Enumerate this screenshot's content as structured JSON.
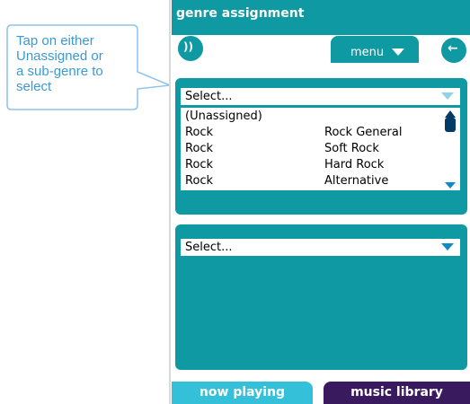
{
  "callout": {
    "lines": [
      "Tap on either",
      "Unassigned or",
      "a sub-genre to",
      "select"
    ]
  },
  "header": {
    "title": "genre assignment"
  },
  "toolbar": {
    "speaker_icon": "speaker-icon",
    "menu_label": "menu",
    "back_icon": "arrow-left-icon"
  },
  "genre_select": {
    "value": "Select...",
    "options": [
      {
        "genre": "(Unassigned)",
        "subgenre": ""
      },
      {
        "genre": "Rock",
        "subgenre": "Rock General"
      },
      {
        "genre": "Rock",
        "subgenre": "Soft Rock"
      },
      {
        "genre": "Rock",
        "subgenre": "Hard Rock"
      },
      {
        "genre": "Rock",
        "subgenre": "Alternative"
      }
    ]
  },
  "second_select": {
    "value": "Select..."
  },
  "tabs": {
    "now_playing": "now playing",
    "music_library": "music library"
  },
  "colors": {
    "teal": "#0e99a3",
    "light_blue": "#35c0d9",
    "purple": "#3a1a5e",
    "callout": "#3a9ad3"
  }
}
